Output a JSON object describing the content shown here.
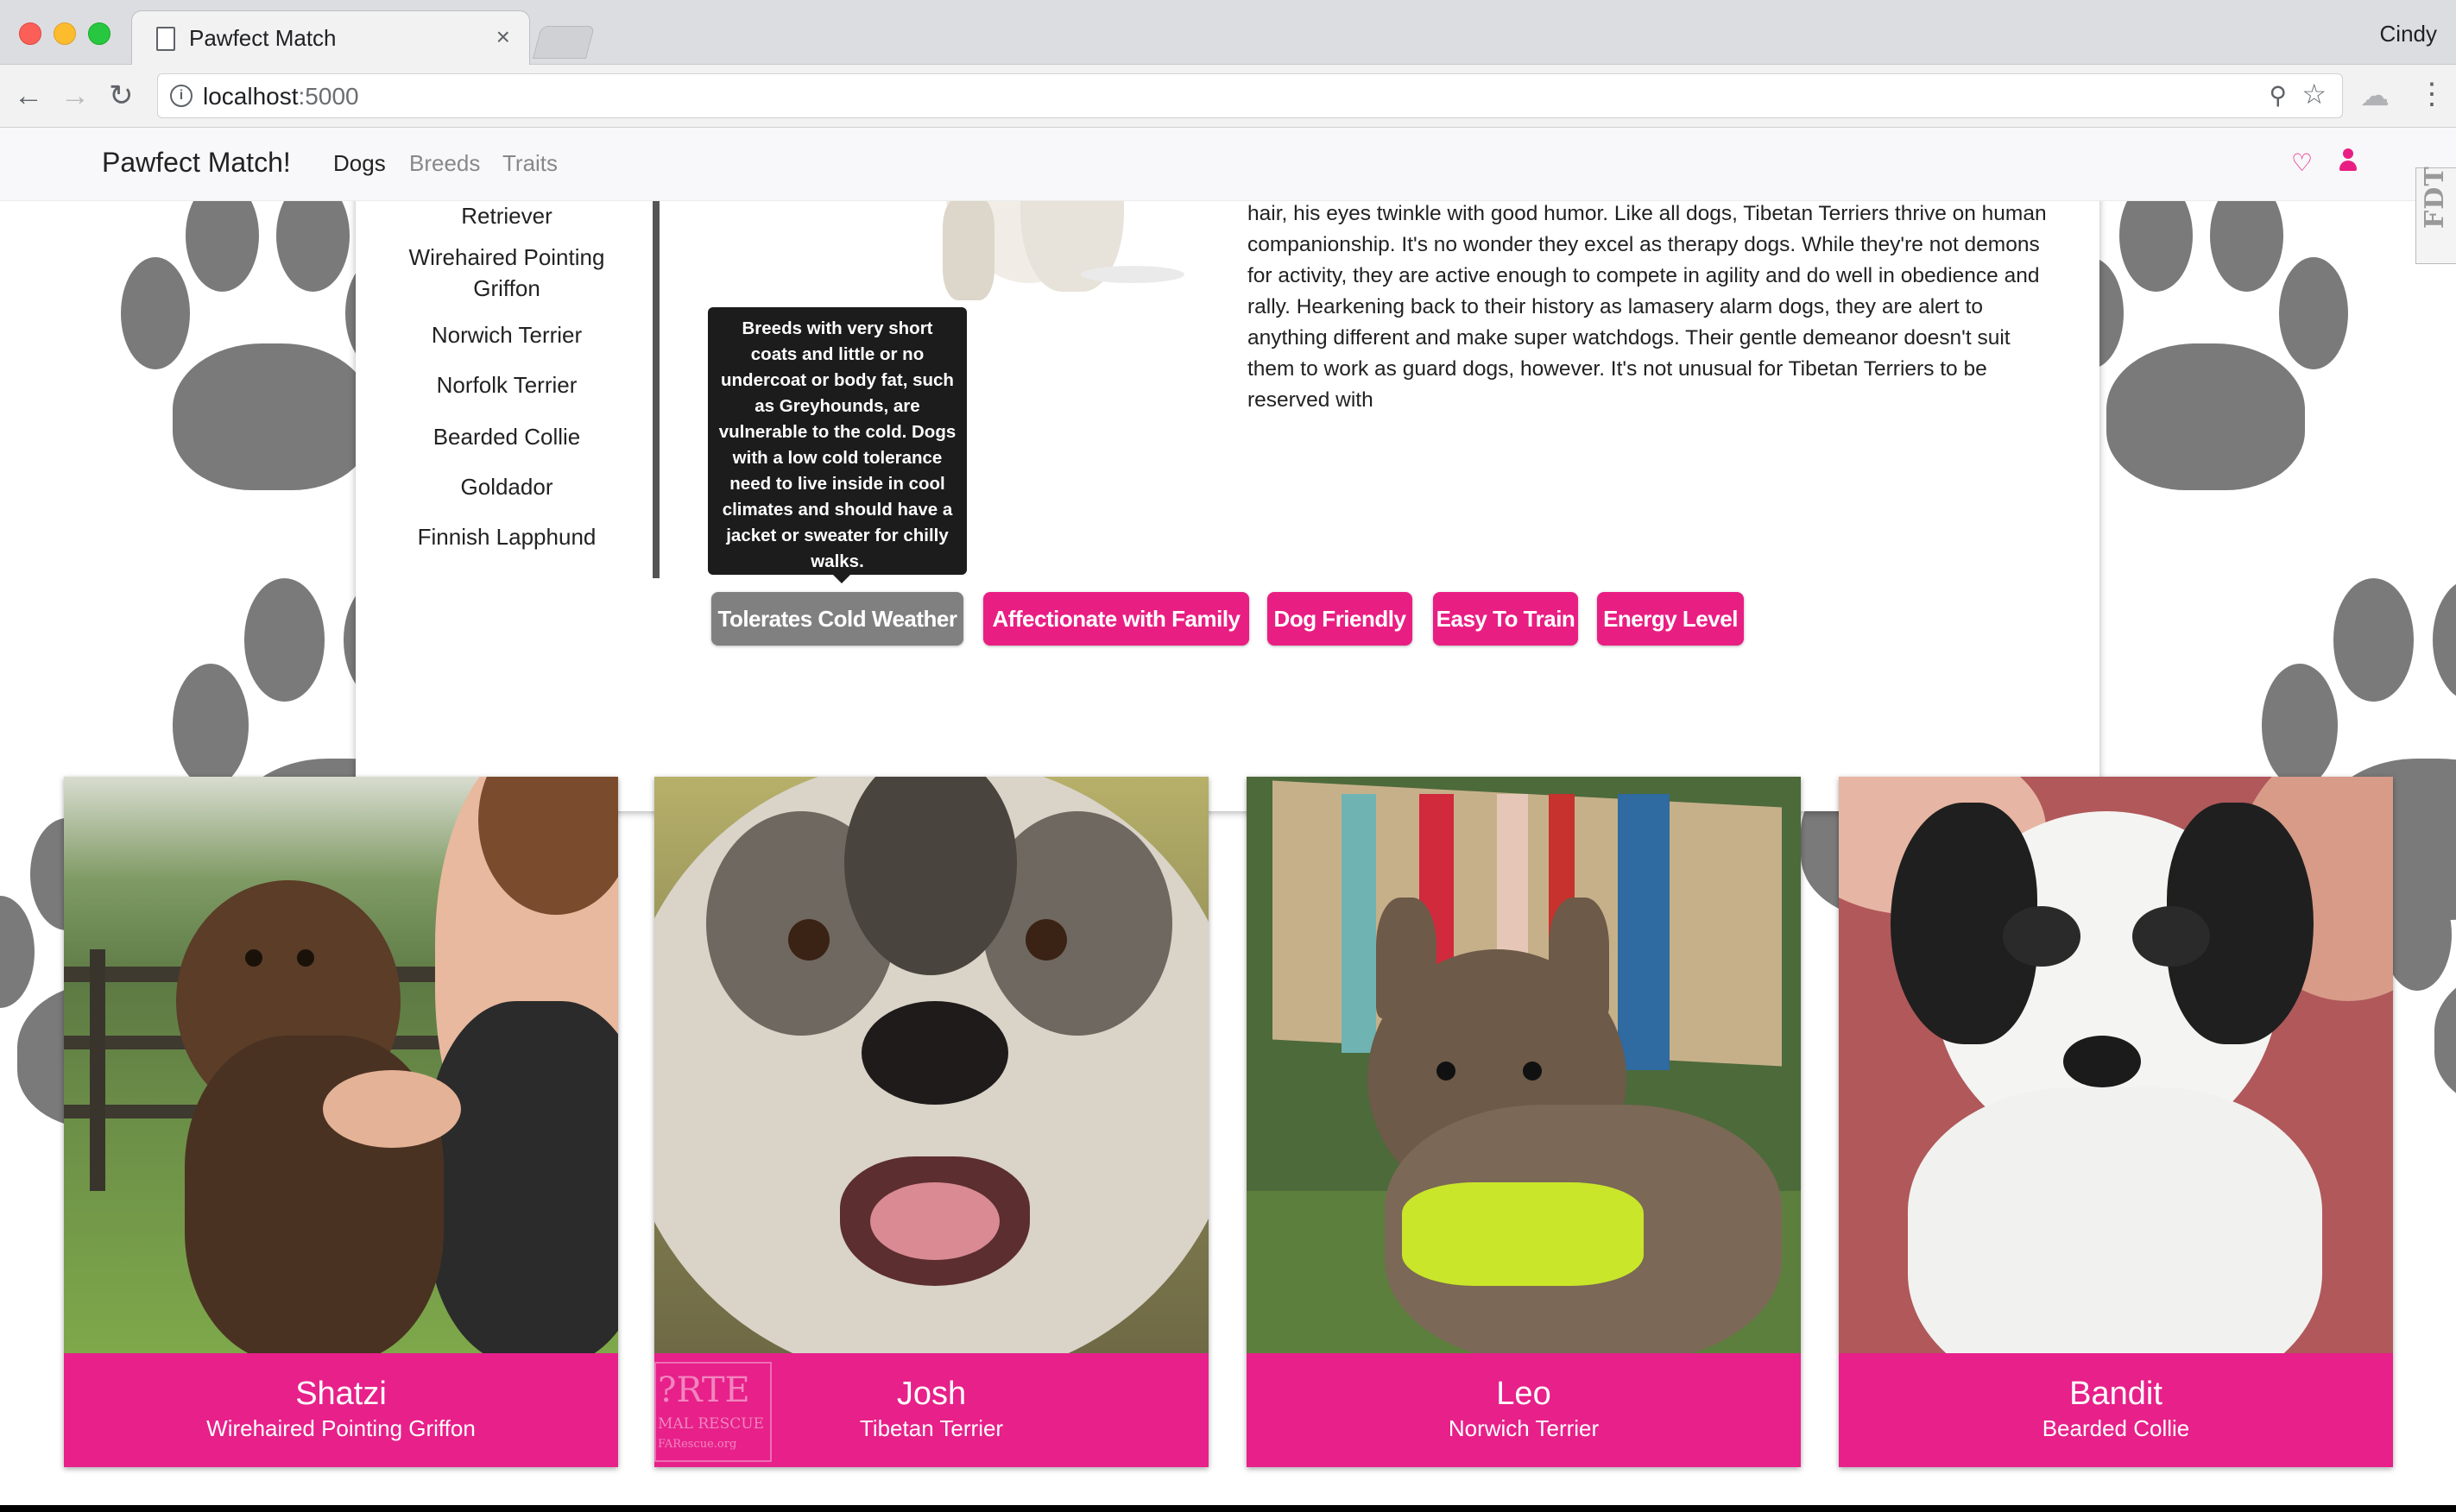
{
  "browser": {
    "tab_title": "Pawfect Match",
    "tab_close": "×",
    "profile": "Cindy",
    "url_host": "localhost",
    "url_port": ":5000",
    "nav_back": "←",
    "nav_forward": "→",
    "nav_reload": "↻",
    "info": "i",
    "zoom_glyph": "⚲",
    "star_glyph": "☆",
    "ext_glyph": "☁",
    "menu_glyph": "⋮"
  },
  "navbar": {
    "brand": "Pawfect Match!",
    "links": [
      "Dogs",
      "Breeds",
      "Traits"
    ],
    "heart_glyph": "♡"
  },
  "side_widget": {
    "label": "FDT"
  },
  "breed_list": {
    "items": [
      "Retriever",
      "Wirehaired Pointing Griffon",
      "Norwich Terrier",
      "Norfolk Terrier",
      "Bearded Collie",
      "Goldador",
      "Finnish Lapphund"
    ]
  },
  "breed_detail": {
    "description": "vermin) or the typically sharp-edged terrier temperament. Lively and fun loving, he is, but those characteristics are tempered with a sweet and kind nature. Beneath a fall of hair, his eyes twinkle with good humor. Like all dogs, Tibetan Terriers thrive on human companionship. It's no wonder they excel as therapy dogs. While they're not demons for activity, they are active enough to compete in agility and do well in obedience and rally. Hearkening back to their history as lamasery alarm dogs, they are alert to anything different and make super watchdogs. Their gentle demeanor doesn't suit them to work as guard dogs, however. It's not unusual for Tibetan Terriers to be reserved with",
    "tooltip": "Breeds with very short coats and little or no undercoat or body fat, such as Greyhounds, are vulnerable to the cold. Dogs with a low cold tolerance need to live inside in cool climates and should have a jacket or sweater for chilly walks.",
    "traits": [
      "Tolerates Cold Weather",
      "Affectionate with Family",
      "Dog Friendly",
      "Easy To Train",
      "Energy Level"
    ],
    "active_trait": "Tolerates Cold Weather"
  },
  "dogs": [
    {
      "name": "Shatzi",
      "breed": "Wirehaired Pointing Griffon"
    },
    {
      "name": "Josh",
      "breed": "Tibetan Terrier",
      "photo_watermark": [
        "?RTE",
        "MAL RESCUE",
        "FARescue.org"
      ]
    },
    {
      "name": "Leo",
      "breed": "Norwich Terrier"
    },
    {
      "name": "Bandit",
      "breed": "Bearded Collie"
    }
  ],
  "colors": {
    "accent": "#e91e83",
    "caption_bg": "#e7208a",
    "active_trait": "#808080",
    "paw": "#7a7a7a"
  }
}
